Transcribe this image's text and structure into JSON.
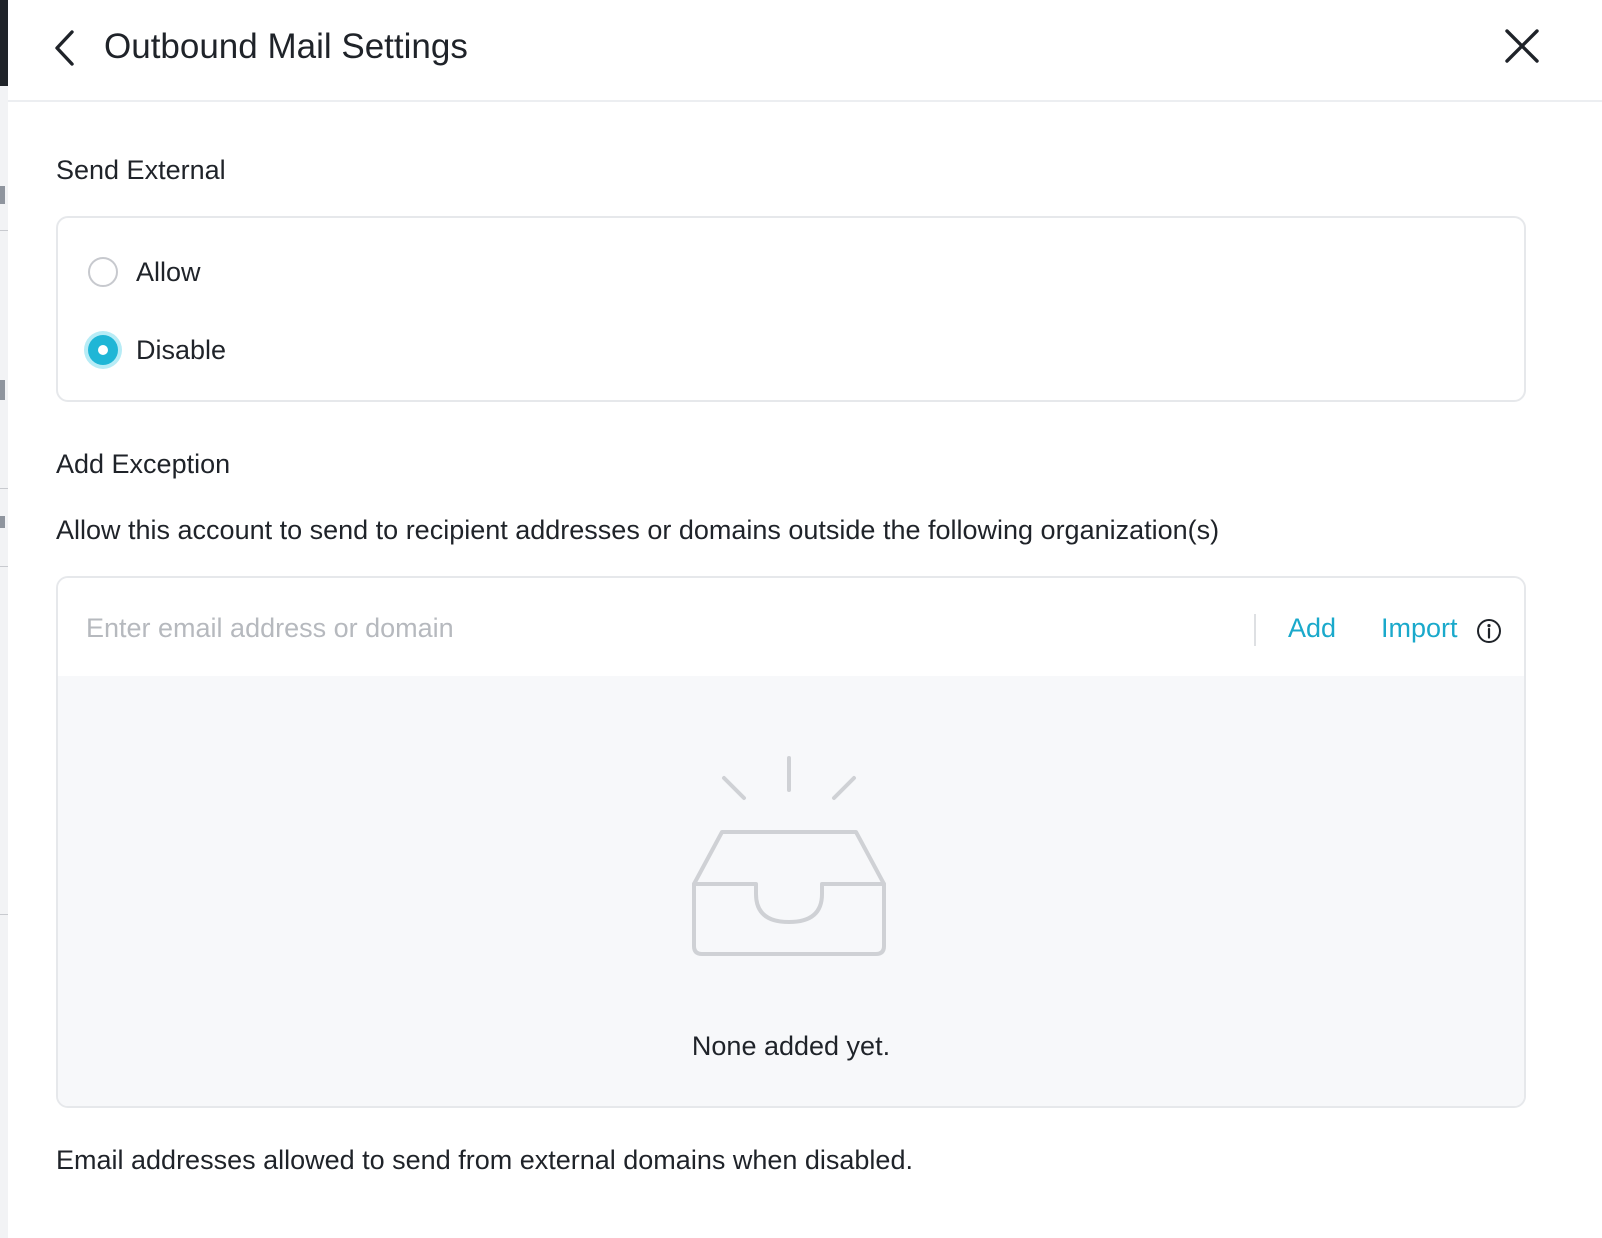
{
  "header": {
    "title": "Outbound Mail Settings",
    "back_icon": "chevron-left-icon",
    "close_icon": "close-icon"
  },
  "send_external": {
    "label": "Send External",
    "options": [
      {
        "label": "Allow",
        "checked": false
      },
      {
        "label": "Disable",
        "checked": true
      }
    ]
  },
  "exception": {
    "label": "Add Exception",
    "description": "Allow this account to send to recipient addresses or domains outside the following organization(s)",
    "input_placeholder": "Enter email address or domain",
    "add_label": "Add",
    "import_label": "Import",
    "import_info_icon": "info-icon",
    "empty_icon": "empty-inbox-icon",
    "empty_text": "None added yet."
  },
  "footer_note": "Email addresses allowed to send from external domains when disabled.",
  "colors": {
    "accent": "#1aa9cb",
    "radio_checked": "#1fb6d6",
    "text": "#1f2329",
    "placeholder": "#b6b9be",
    "empty_bg": "#f7f8fa"
  }
}
